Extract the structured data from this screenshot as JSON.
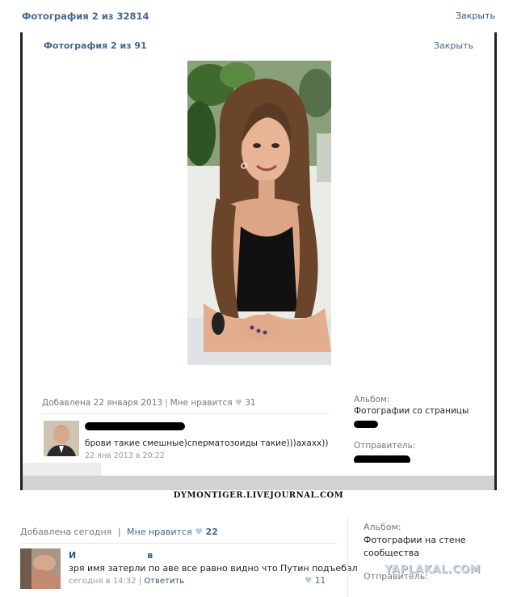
{
  "outer": {
    "title": "Фотография 2 из 32814",
    "close_label": "Закрыть",
    "added": "Добавлена сегодня",
    "separator": "|",
    "likes_label": "Мне нравится",
    "likes_count": "22",
    "comment": {
      "author_initial": "И",
      "author_end": "в",
      "text": "зря имя затерли по аве все равно видно что Путин подъебал",
      "date": "сегодня в 14:32",
      "reply_label": "Ответить",
      "likes": "11"
    },
    "sidebar": {
      "album_label": "Альбом:",
      "album_value": "Фотографии на стене сообщества",
      "sender_label": "Отправитель:"
    }
  },
  "inner": {
    "title": "Фотография 2 из 91",
    "close_label": "Закрыть",
    "added": "Добавлена 22 января 2013",
    "separator": "|",
    "likes_label": "Мне нравится",
    "likes_count": "31",
    "comment": {
      "text": "брови такие смешные)сперматозоиды такие)))ахахх))",
      "date": "22 янв 2013 в 20:22"
    },
    "sidebar": {
      "album_label": "Альбом:",
      "album_value": "Фотографии со страницы",
      "sender_label": "Отправитель:"
    }
  },
  "watermark": "DYMONTIGER.LIVEJOURNAL.COM",
  "site_watermark": "YAPLAKAL.COM",
  "colors": {
    "link": "#45688e",
    "accent_dark": "#2b587a",
    "muted": "#777777",
    "heart": "#b8c9db"
  }
}
